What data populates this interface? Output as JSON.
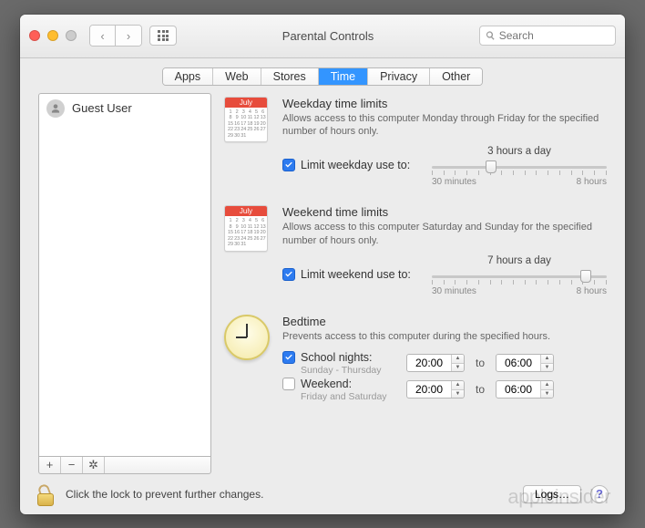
{
  "window": {
    "title": "Parental Controls"
  },
  "search": {
    "placeholder": "Search"
  },
  "tabs": [
    "Apps",
    "Web",
    "Stores",
    "Time",
    "Privacy",
    "Other"
  ],
  "active_tab": "Time",
  "sidebar": {
    "users": [
      {
        "name": "Guest User"
      }
    ],
    "buttons": {
      "add": "+",
      "remove": "−",
      "gear": "✻"
    }
  },
  "weekday": {
    "icon_month": "July",
    "title": "Weekday time limits",
    "desc": "Allows access to this computer Monday through Friday for the specified number of hours only.",
    "checkbox_label": "Limit weekday use to:",
    "checked": true,
    "value_label": "3 hours a day",
    "min_label": "30 minutes",
    "max_label": "8 hours",
    "slider_percent": 34
  },
  "weekend": {
    "icon_month": "July",
    "title": "Weekend time limits",
    "desc": "Allows access to this computer Saturday and Sunday for the specified number of hours only.",
    "checkbox_label": "Limit weekend use to:",
    "checked": true,
    "value_label": "7 hours a day",
    "min_label": "30 minutes",
    "max_label": "8 hours",
    "slider_percent": 88
  },
  "bedtime": {
    "title": "Bedtime",
    "desc": "Prevents access to this computer during the specified hours.",
    "school": {
      "label": "School nights:",
      "sub": "Sunday - Thursday",
      "checked": true,
      "from": "20:00",
      "to_label": "to",
      "to": "06:00"
    },
    "wkend": {
      "label": "Weekend:",
      "sub": "Friday and Saturday",
      "checked": false,
      "from": "20:00",
      "to_label": "to",
      "to": "06:00"
    }
  },
  "footer": {
    "lock_text": "Click the lock to prevent further changes.",
    "logs_button": "Logs…",
    "help": "?"
  },
  "watermark": "appleinsider"
}
